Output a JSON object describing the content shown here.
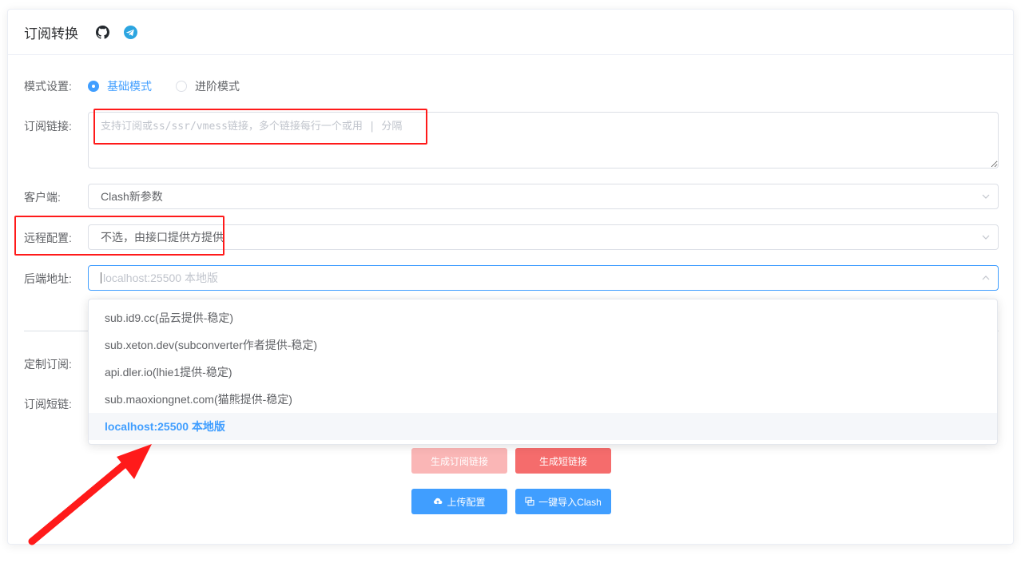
{
  "header": {
    "title": "订阅转换",
    "icons": [
      "github-icon",
      "telegram-icon"
    ]
  },
  "form": {
    "mode": {
      "label": "模式设置:",
      "options": [
        "基础模式",
        "进阶模式"
      ],
      "selected": "基础模式"
    },
    "subscription": {
      "label": "订阅链接:",
      "placeholder": "支持订阅或ss/ssr/vmess链接，多个链接每行一个或用 | 分隔"
    },
    "client": {
      "label": "客户端:",
      "value": "Clash新参数"
    },
    "remote_config": {
      "label": "远程配置:",
      "value": "不选，由接口提供方提供"
    },
    "backend": {
      "label": "后端地址:",
      "placeholder": "localhost:25500 本地版",
      "options": [
        "sub.id9.cc(品云提供-稳定)",
        "sub.xeton.dev(subconverter作者提供-稳定)",
        "api.dler.io(lhie1提供-稳定)",
        "sub.maoxiongnet.com(猫熊提供-稳定)",
        "localhost:25500 本地版"
      ],
      "selected": "localhost:25500 本地版"
    },
    "custom_sub_label": "定制订阅:",
    "short_link_label": "订阅短链:"
  },
  "buttons": {
    "generate_sub": "生成订阅链接",
    "generate_short": "生成短链接",
    "upload_config": "上传配置",
    "import_clash": "一键导入Clash"
  },
  "colors": {
    "primary": "#409eff",
    "danger": "#f56c6c",
    "danger_light": "#fab6b6",
    "annotation": "#ff1a1a"
  }
}
